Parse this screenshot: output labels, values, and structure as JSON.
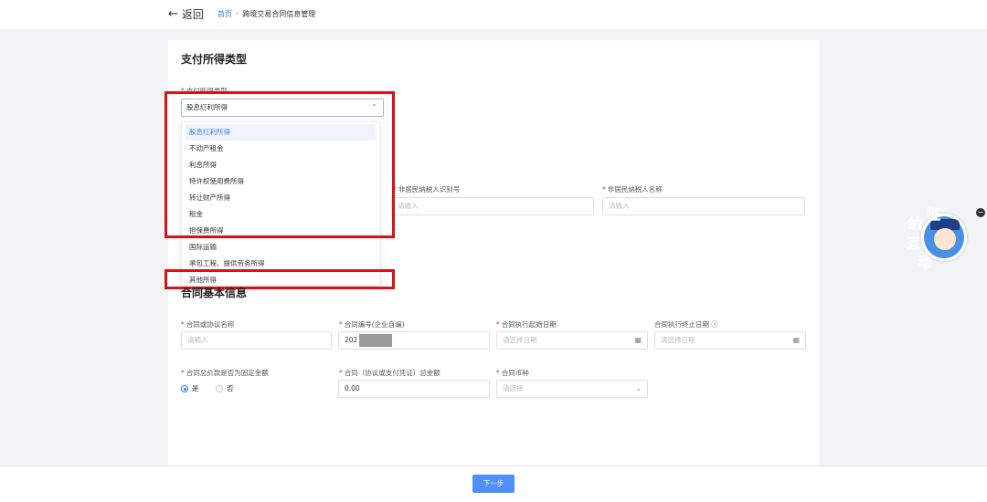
{
  "header": {
    "back_label": "返回",
    "breadcrumb": {
      "home": "首页",
      "separator": "›",
      "current": "跨境交易合同信息管理"
    }
  },
  "income_section": {
    "title": "支付所得类型",
    "field_label": "支付所得类型",
    "selected_value": "股息红利所得",
    "options": [
      "股息红利所得",
      "不动产租金",
      "利息所得",
      "特许权使用费所得",
      "转让财产所得",
      "租金",
      "担保费所得",
      "国际运输",
      "承包工程、提供劳务所得",
      "其他所得"
    ]
  },
  "taxpayer": {
    "id_label": "非居民纳税人识别号",
    "id_placeholder": "请输入",
    "name_label": "非居民纳税人名称",
    "name_placeholder": "请输入"
  },
  "contract_section": {
    "title": "合同基本信息",
    "name_label": "合同或协议名称",
    "name_placeholder": "请输入",
    "number_label": "合同编号(企业自编)",
    "number_value": "202",
    "start_label": "合同执行起始日期",
    "start_placeholder": "请选择日期",
    "end_label": "合同执行终止日期",
    "end_placeholder": "请选择日期",
    "fixed_label": "合同总价款是否为固定金额",
    "radio_yes": "是",
    "radio_no": "否",
    "amount_label": "合同（协议或支付凭证）总金额",
    "amount_value": "0.00",
    "currency_label": "合同币种",
    "currency_placeholder": "请选择"
  },
  "footer": {
    "next_label": "下一步"
  },
  "mascot": {
    "chars": [
      "征",
      "纳",
      "互",
      "动"
    ]
  },
  "colors": {
    "accent": "#2f7cf6",
    "highlight_box": "#d8101a",
    "required": "#e03030"
  }
}
